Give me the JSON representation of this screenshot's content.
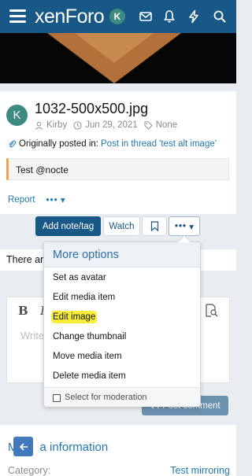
{
  "header": {
    "logo": "xenForo",
    "avatar_letter": "K",
    "icons": [
      "menu-icon",
      "envelope-icon",
      "bell-icon",
      "lightning-icon"
    ],
    "bg_color": "#185886"
  },
  "media": {
    "title": "1032-500x500.jpg",
    "avatar_letter": "K",
    "author": "Kirby",
    "date": "Jun 29, 2021",
    "tags": "None",
    "posted_prefix": "Originally posted in:",
    "posted_link": "Post in thread 'test alt image'",
    "description": "Test @nocte",
    "report": "Report",
    "more": "•••"
  },
  "actions": {
    "add_note": "Add note/tag",
    "watch": "Watch",
    "more": "•••"
  },
  "comments": {
    "partial_text": "There ar",
    "placeholder": "Write",
    "post_button": "Post comment"
  },
  "menu": {
    "title": "More options",
    "items": [
      "Set as avatar",
      "Edit media item",
      "Edit image",
      "Change thumbnail",
      "Move media item",
      "Delete media item"
    ],
    "moderation": "Select for moderation",
    "highlight_color": "#f7ed3a"
  },
  "info": {
    "title_start": "M",
    "title_end": "a information",
    "category_label": "Category:",
    "category_value": "Test mirroring"
  }
}
